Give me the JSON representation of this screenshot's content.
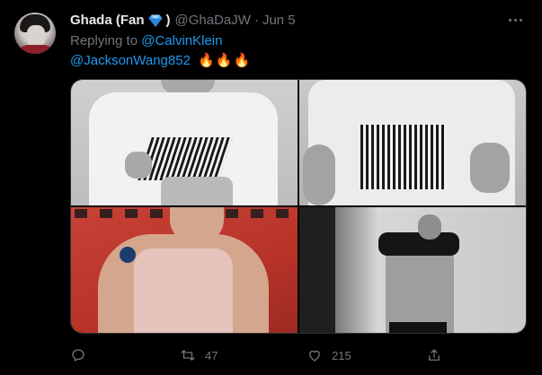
{
  "tweet": {
    "author_name": "Ghada (Fan",
    "author_name_suffix": ")",
    "handle": "@GhaDaJW",
    "separator": "·",
    "date": "Jun 5",
    "replying_prefix": "Replying to",
    "replying_to": "@CalvinKlein",
    "mention": "@JacksonWang852",
    "emojis": "🔥🔥🔥",
    "verified_icon": "blue-diamond-icon"
  },
  "media": {
    "photos": [
      {
        "label": "photo-1",
        "tone": "grayscale"
      },
      {
        "label": "photo-2",
        "tone": "grayscale"
      },
      {
        "label": "photo-3",
        "tone": "red"
      },
      {
        "label": "photo-4",
        "tone": "grayscale"
      }
    ]
  },
  "actions": {
    "reply_count": "",
    "retweet_count": "47",
    "like_count": "215",
    "share_count": ""
  },
  "colors": {
    "background": "#000000",
    "text_primary": "#e7e9ea",
    "text_secondary": "#71767b",
    "link": "#1d9bf0"
  }
}
